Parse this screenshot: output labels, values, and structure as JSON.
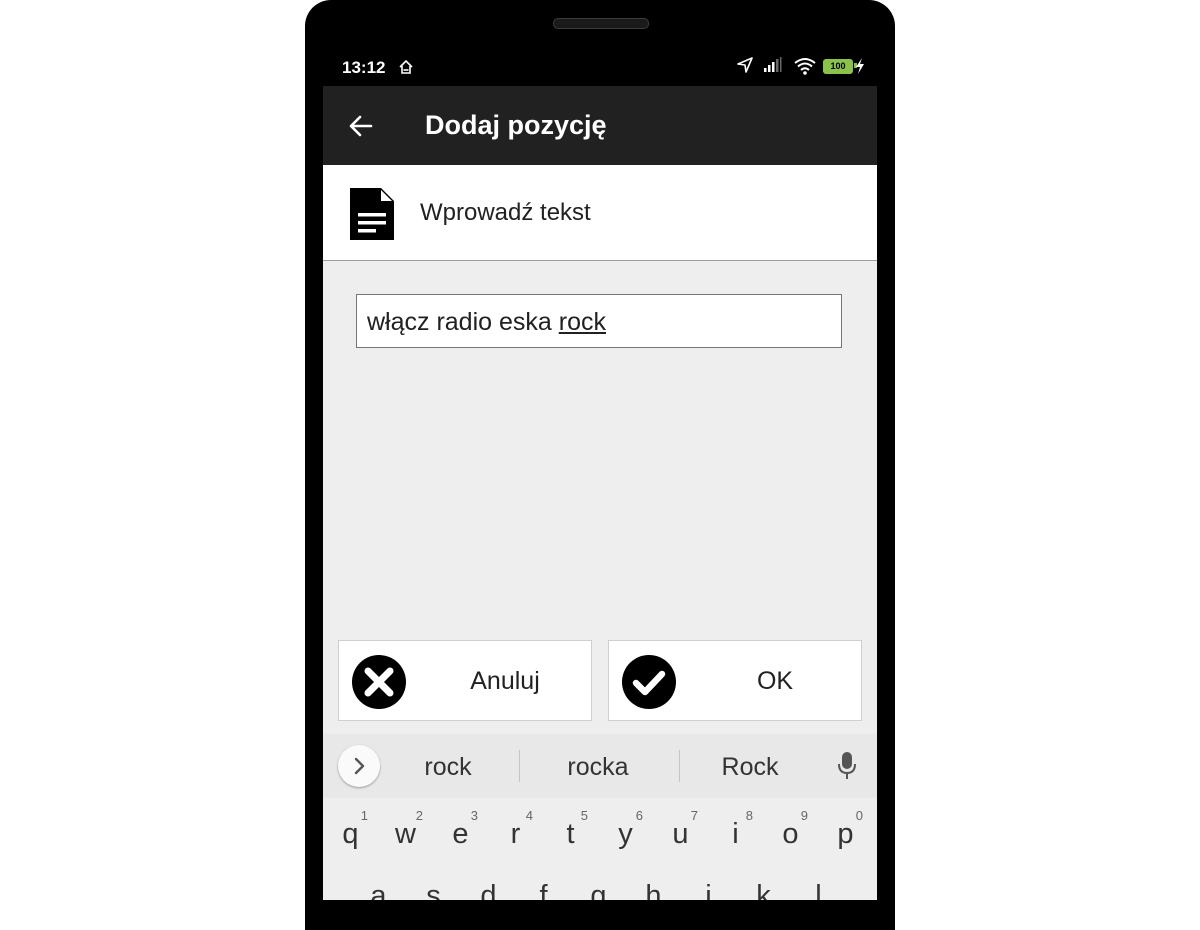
{
  "status_bar": {
    "time": "13:12",
    "battery_level": "100",
    "icons": [
      "home-outline-icon",
      "location-arrow-icon",
      "signal-icon",
      "wifi-icon",
      "battery-icon",
      "charging-bolt-icon"
    ]
  },
  "app_bar": {
    "title": "Dodaj pozycję",
    "back_icon": "arrow-left-icon"
  },
  "header": {
    "icon": "document-icon",
    "title": "Wprowadź tekst"
  },
  "input": {
    "value_prefix": "włącz radio eska ",
    "value_composing": "rock"
  },
  "buttons": {
    "cancel_label": "Anuluj",
    "ok_label": "OK"
  },
  "keyboard": {
    "suggestions": [
      "rock",
      "rocka",
      "Rock"
    ],
    "row1": [
      {
        "char": "q",
        "hint": "1"
      },
      {
        "char": "w",
        "hint": "2"
      },
      {
        "char": "e",
        "hint": "3"
      },
      {
        "char": "r",
        "hint": "4"
      },
      {
        "char": "t",
        "hint": "5"
      },
      {
        "char": "y",
        "hint": "6"
      },
      {
        "char": "u",
        "hint": "7"
      },
      {
        "char": "i",
        "hint": "8"
      },
      {
        "char": "o",
        "hint": "9"
      },
      {
        "char": "p",
        "hint": "0"
      }
    ],
    "row2": [
      "a",
      "s",
      "d",
      "f",
      "g",
      "h",
      "j",
      "k",
      "l"
    ]
  },
  "colors": {
    "app_bar": "#212121",
    "screen_background": "#eeeeee",
    "battery": "#8bc34a"
  }
}
